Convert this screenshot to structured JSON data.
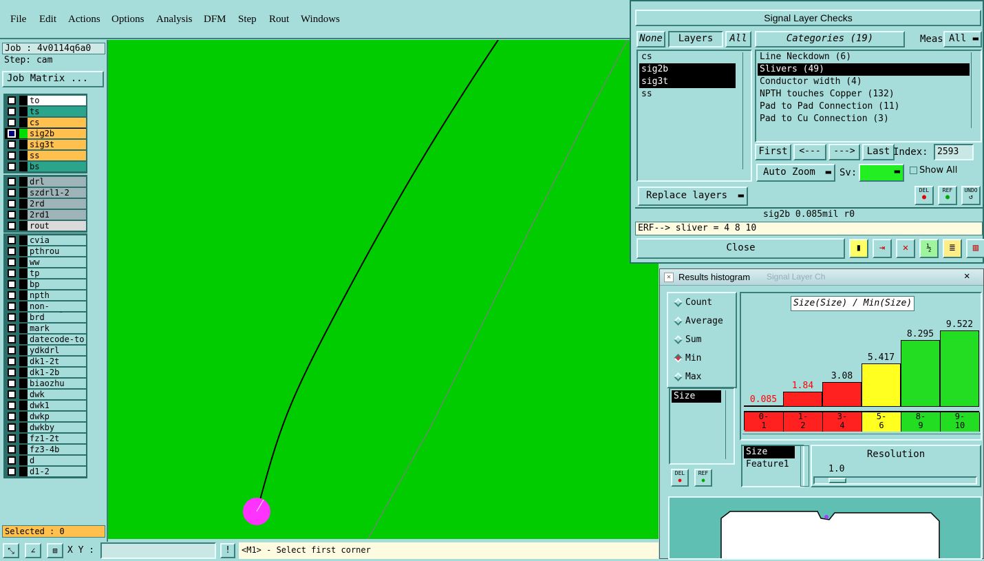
{
  "menu": [
    "File",
    "Edit",
    "Actions",
    "Options",
    "Analysis",
    "DFM",
    "Step",
    "Rout",
    "Windows"
  ],
  "job": {
    "job_label": "Job : 4v0114q6a0",
    "step_label": "Step: cam",
    "matrix_button": "Job Matrix ..."
  },
  "layers_group1": [
    {
      "name": "to",
      "bg": "#ffffff"
    },
    {
      "name": "ts",
      "bg": "#2aa58c"
    },
    {
      "name": "cs",
      "bg": "#ffc04d"
    },
    {
      "name": "sig2b",
      "bg": "#ffc04d",
      "selected": true
    },
    {
      "name": "sig3t",
      "bg": "#ffc04d"
    },
    {
      "name": "ss",
      "bg": "#ffc04d"
    },
    {
      "name": "bs",
      "bg": "#2aa58c"
    }
  ],
  "layers_group2": [
    {
      "name": "drl",
      "bg": "#9fb4b8"
    },
    {
      "name": "szdrl1-2",
      "bg": "#9fb4b8"
    },
    {
      "name": "2rd",
      "bg": "#9fb4b8"
    },
    {
      "name": "2rd1",
      "bg": "#9fb4b8"
    },
    {
      "name": "rout",
      "bg": "#dadada"
    }
  ],
  "layers_group3": [
    "cvia",
    "pthrou",
    "ww",
    "tp",
    "bp",
    "npth",
    "non-edge_pla",
    "brd",
    "mark",
    "datecode-to",
    "ydkdrl",
    "dk1-2t",
    "dk1-2b",
    "biaozhu",
    "dwk",
    "dwk1",
    "dwkp",
    "dwkby",
    "fz1-2t",
    "fz3-4b",
    "d",
    "d1-2"
  ],
  "selected_label": "Selected : 0",
  "bottom": {
    "xy_label": "X Y :",
    "xy_value": "",
    "status": "<M1> - Select first corner"
  },
  "slc": {
    "title": "Signal Layer Checks",
    "none": "None",
    "layers": "Layers",
    "all": "All",
    "categories_btn": "Categories (19)",
    "meas_label": "Meas:",
    "meas_value": "All",
    "layer_list": [
      {
        "name": "cs",
        "sel": false
      },
      {
        "name": "sig2b",
        "sel": true
      },
      {
        "name": "sig3t",
        "sel": true
      },
      {
        "name": "ss",
        "sel": false
      }
    ],
    "category_list": [
      {
        "name": "Line Neckdown (6)",
        "sel": false
      },
      {
        "name": "Slivers (49)",
        "sel": true
      },
      {
        "name": "Conductor width (4)",
        "sel": false
      },
      {
        "name": "NPTH touches Copper (132)",
        "sel": false
      },
      {
        "name": "Pad to Pad Connection (11)",
        "sel": false
      },
      {
        "name": "Pad to Cu Connection (3)",
        "sel": false
      }
    ],
    "first": "First",
    "prev": "<---",
    "next": "--->",
    "last": "Last",
    "index_label": "Index:",
    "index_value": "2593",
    "auto_zoom": "Auto Zoom",
    "sv_label": "Sv:",
    "show_all": "Show All",
    "replace_layers": "Replace layers",
    "del": "DEL",
    "ref": "REF",
    "undo": "UNDO",
    "info_line": "sig2b 0.085mil  r0",
    "erf_line": "ERF--> sliver = 4 8 10",
    "close": "Close"
  },
  "hist": {
    "title": "Results histogram",
    "bg_title": "Signal Layer Ch",
    "radios": [
      {
        "label": "Count",
        "on": false
      },
      {
        "label": "Average",
        "on": false
      },
      {
        "label": "Sum",
        "on": false
      },
      {
        "label": "Min",
        "on": true
      },
      {
        "label": "Max",
        "on": false
      }
    ],
    "list_left": "Size",
    "chart_title": "Size(Size) / Min(Size)",
    "list_bottom": [
      {
        "name": "Size",
        "sel": true
      },
      {
        "name": "Feature1",
        "sel": false
      }
    ],
    "resolution_label": "Resolution",
    "resolution_value": "1.0",
    "del": "DEL",
    "ref": "REF"
  },
  "chart_data": {
    "type": "bar",
    "title": "Size(Size) / Min(Size)",
    "categories": [
      "0-1",
      "1-2",
      "3-4",
      "5-6",
      "8-9",
      "9-10"
    ],
    "category_lines": [
      [
        "0-",
        "1"
      ],
      [
        "1-",
        "2"
      ],
      [
        "3-",
        "4"
      ],
      [
        "5-",
        "6"
      ],
      [
        "8-",
        "9"
      ],
      [
        "9-",
        "10"
      ]
    ],
    "values": [
      0.085,
      1.84,
      3.08,
      5.417,
      8.295,
      9.522
    ],
    "labels": [
      "0.085",
      "1.84",
      "3.08",
      "5.417",
      "8.295",
      "9.522"
    ],
    "colors": [
      "#ff2020",
      "#ff2020",
      "#ff2020",
      "#ffff20",
      "#22dd22",
      "#22dd22"
    ],
    "label_colors": [
      "#ff0000",
      "#ff0000",
      "#000000",
      "#000000",
      "#000000",
      "#000000"
    ],
    "ylim": [
      0,
      10
    ]
  }
}
